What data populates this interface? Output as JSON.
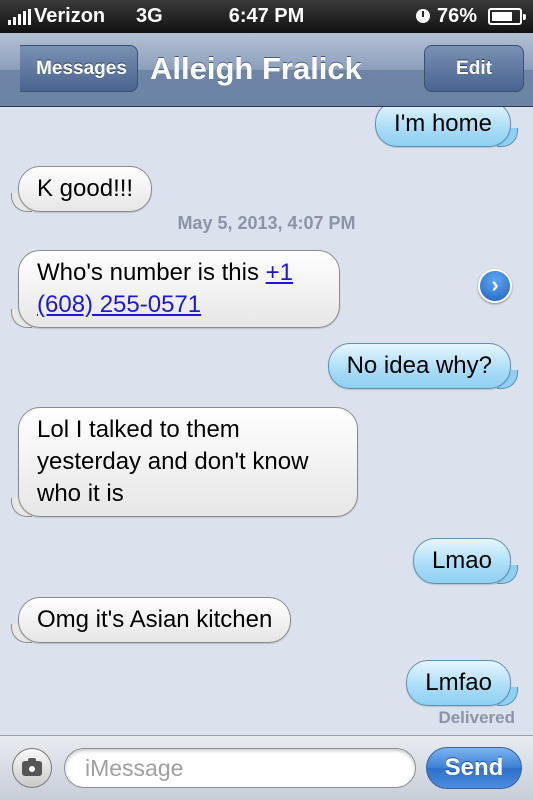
{
  "status_bar": {
    "carrier": "Verizon",
    "network": "3G",
    "time": "6:47 PM",
    "battery": "76%",
    "battery_level": 0.76
  },
  "nav": {
    "back_label": "Messages",
    "title": "Alleigh Fralick",
    "edit_label": "Edit"
  },
  "thread": {
    "messages": [
      {
        "direction": "out",
        "text": "I'm home"
      },
      {
        "direction": "in",
        "text": "K good!!!"
      },
      {
        "direction": "in",
        "text_prefix": "Who's number is this ",
        "link_text": "+1 (608) 255-0571"
      },
      {
        "direction": "out",
        "text": "No idea why?"
      },
      {
        "direction": "in",
        "text": "Lol I talked to them yesterday and don't know who it is"
      },
      {
        "direction": "out",
        "text": "Lmao"
      },
      {
        "direction": "in",
        "text": "Omg it's Asian kitchen"
      },
      {
        "direction": "out",
        "text": "Lmfao"
      }
    ],
    "timestamp": "May 5, 2013, 4:07 PM",
    "delivered_label": "Delivered"
  },
  "input_bar": {
    "placeholder": "iMessage",
    "value": "",
    "send_label": "Send"
  },
  "colors": {
    "background": "#dbe2ed",
    "nav_bar": "#6c83a5",
    "outgoing_bubble": "#a9dcf7",
    "incoming_bubble": "#ffffff",
    "send_button": "#3b80d6",
    "link": "#1a1ad4"
  }
}
